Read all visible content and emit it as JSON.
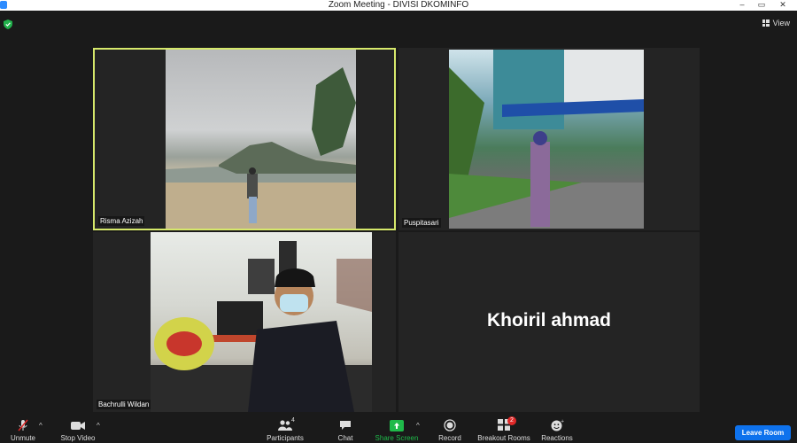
{
  "window": {
    "title": "Zoom Meeting - DIVISI DKOMINFO",
    "minimize": "–",
    "maximize": "▭",
    "close": "✕"
  },
  "topbar": {
    "view_label": "View",
    "encryption_color": "#22b14c"
  },
  "participants": [
    {
      "name": "Risma Azizah",
      "video": "on",
      "active_speaker": true
    },
    {
      "name": "Puspitasari",
      "video": "on"
    },
    {
      "name": "Bachrulli Wildan",
      "video": "on"
    },
    {
      "name": "Khoiril ahmad",
      "video": "off"
    }
  ],
  "toolbar": {
    "unmute": "Unmute",
    "stop_video": "Stop Video",
    "participants": "Participants",
    "participants_count": "4",
    "chat": "Chat",
    "share_screen": "Share Screen",
    "record": "Record",
    "breakout_rooms": "Breakout Rooms",
    "breakout_badge": "2",
    "reactions": "Reactions",
    "leave": "Leave Room"
  },
  "colors": {
    "accent": "#0e72ed",
    "active_border": "#d6e86b",
    "share_green": "#1fba4a"
  }
}
